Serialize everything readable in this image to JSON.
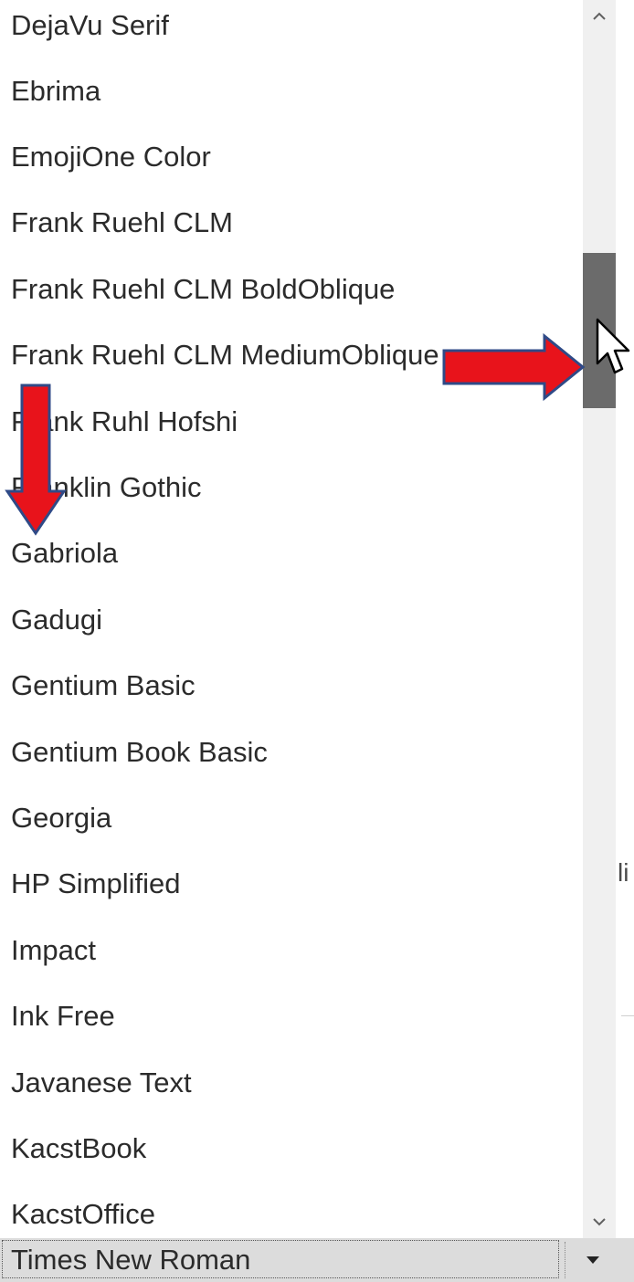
{
  "font_list": {
    "items": [
      "DejaVu Serif",
      "Ebrima",
      "EmojiOne Color",
      "Frank Ruehl CLM",
      "Frank Ruehl CLM BoldOblique",
      "Frank Ruehl CLM MediumOblique",
      "Frank Ruhl Hofshi",
      "Franklin Gothic",
      "Gabriola",
      "Gadugi",
      "Gentium Basic",
      "Gentium Book Basic",
      "Georgia",
      "HP Simplified",
      "Impact",
      "Ink Free",
      "Javanese Text",
      "KacstBook",
      "KacstOffice"
    ]
  },
  "font_combobox": {
    "value": "Times New Roman",
    "button_icon": "caret-down-icon"
  },
  "scrollbar": {
    "up_icon": "chevron-up-icon",
    "down_icon": "chevron-down-icon"
  },
  "background_text": {
    "partial_char": "li"
  },
  "annotations": {
    "arrow_color": "#e8131b",
    "arrow_outline": "#2f4a87",
    "cursor_icon": "mouse-pointer-icon"
  }
}
